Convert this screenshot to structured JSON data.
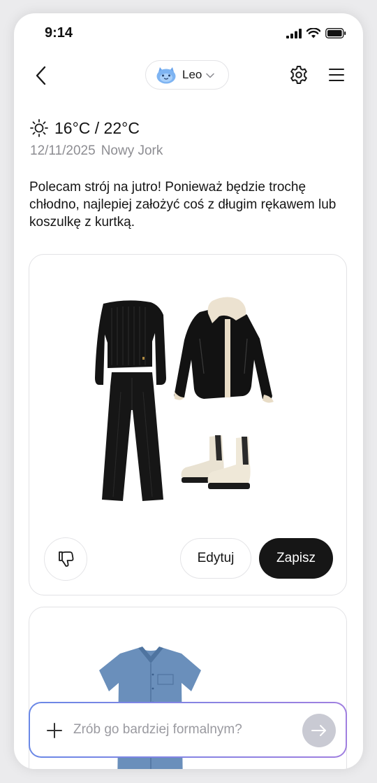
{
  "status_bar": {
    "time": "9:14"
  },
  "header": {
    "agent_name": "Leo"
  },
  "weather": {
    "temperature": "16°C / 22°C",
    "date": "12/11/2025",
    "location": "Nowy Jork"
  },
  "message": "Polecam strój na jutro! Ponieważ będzie trochę chłodno, najlepiej założyć coś z długim rękawem lub koszulkę z kurtką.",
  "outfit_card": {
    "edit_label": "Edytuj",
    "save_label": "Zapisz"
  },
  "input": {
    "placeholder": "Zrób go bardziej formalnym?"
  },
  "colors": {
    "accent_dark": "#161616",
    "input_gradient_start": "#6a88e6",
    "input_gradient_end": "#a07fe0"
  }
}
